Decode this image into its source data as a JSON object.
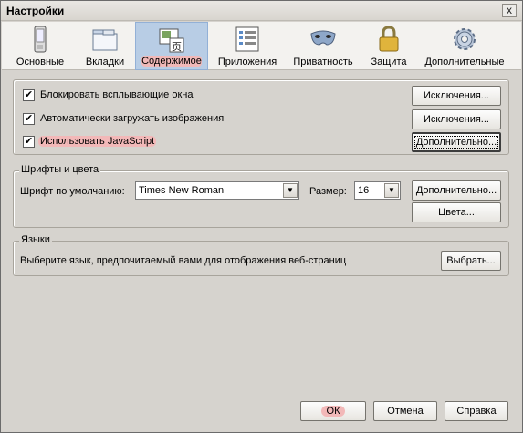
{
  "window": {
    "title": "Настройки",
    "close_glyph": "x"
  },
  "toolbar": {
    "items": [
      {
        "label": "Основные",
        "icon": "phone-icon"
      },
      {
        "label": "Вкладки",
        "icon": "tabs-window-icon"
      },
      {
        "label": "Содержимое",
        "icon": "content-page-icon",
        "selected": true
      },
      {
        "label": "Приложения",
        "icon": "applications-list-icon"
      },
      {
        "label": "Приватность",
        "icon": "mask-icon"
      },
      {
        "label": "Защита",
        "icon": "lock-icon"
      },
      {
        "label": "Дополнительные",
        "icon": "gear-icon"
      }
    ]
  },
  "content": {
    "block_popups": {
      "label": "Блокировать всплывающие окна",
      "checked": true,
      "check_glyph": "✔"
    },
    "load_images": {
      "label": "Автоматически загружать изображения",
      "checked": true,
      "check_glyph": "✔"
    },
    "use_js": {
      "label": "Использовать JavaScript",
      "checked": true,
      "check_glyph": "✔"
    },
    "exceptions_1": "Исключения...",
    "exceptions_2": "Исключения...",
    "advanced": "Дополнительно..."
  },
  "fonts": {
    "legend": "Шрифты и цвета",
    "default_font_label": "Шрифт по умолчанию:",
    "default_font_value": "Times New Roman",
    "size_label": "Размер:",
    "size_value": "16",
    "advanced": "Дополнительно...",
    "colors": "Цвета..."
  },
  "languages": {
    "legend": "Языки",
    "description": "Выберите язык, предпочитаемый вами для отображения веб-страниц",
    "choose": "Выбрать..."
  },
  "footer": {
    "ok": "ОК",
    "cancel": "Отмена",
    "help": "Справка"
  },
  "colors": {
    "selected_tab_bg": "#b8cde5",
    "highlight": "#f2b8b8",
    "dialog_bg": "#d6d3ce"
  }
}
